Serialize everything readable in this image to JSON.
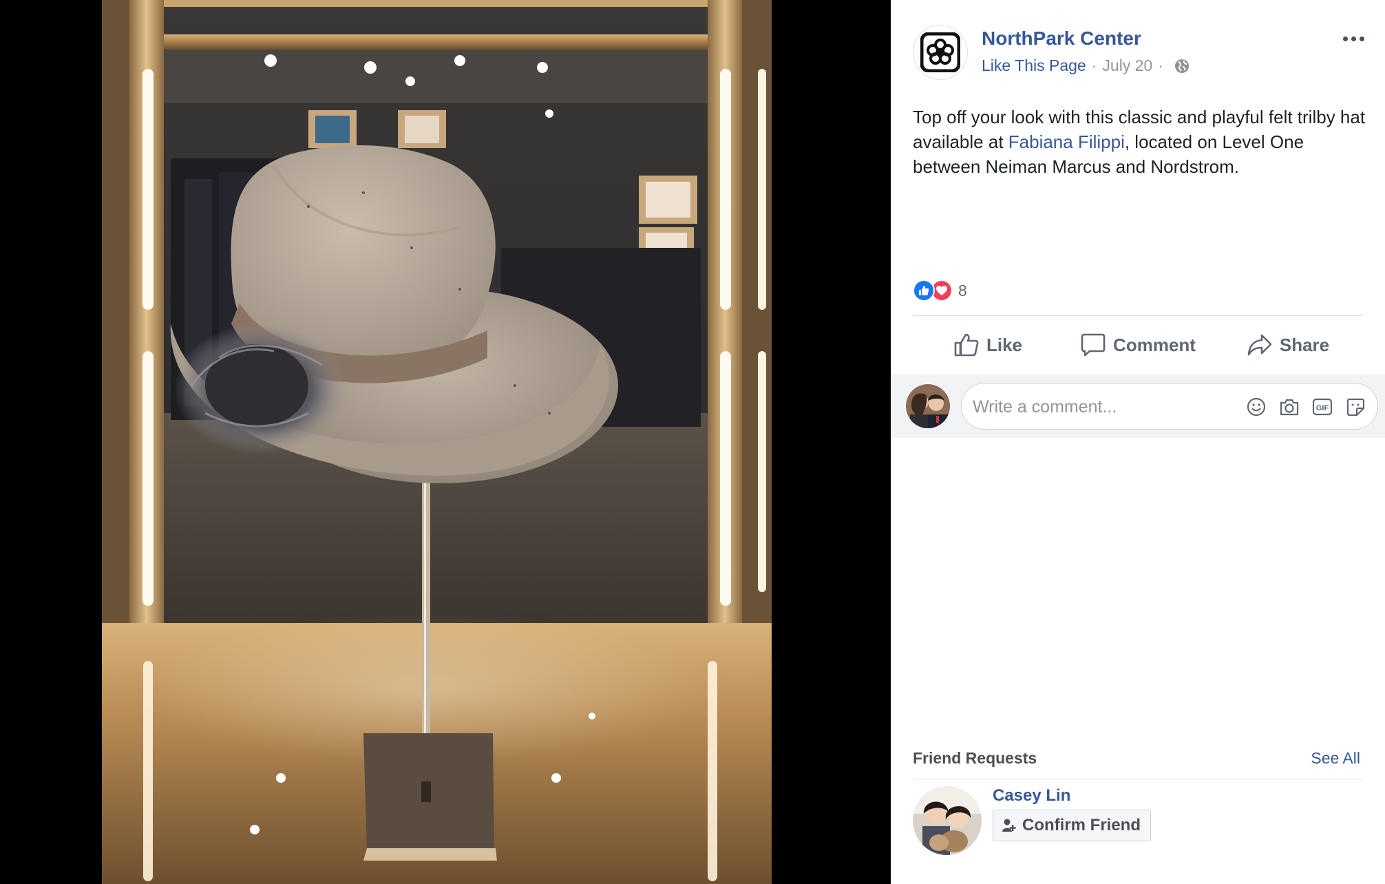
{
  "page": {
    "name": "NorthPark Center",
    "like_link": "Like This Page",
    "separator": "·",
    "date": "July 20"
  },
  "post": {
    "text_before": "Top off your look with this classic and playful felt trilby hat available at ",
    "tag": "Fabiana Filippi",
    "text_after": ", located on Level One between Neiman Marcus and Nordstrom."
  },
  "reactions": {
    "count": "8",
    "types": [
      "like-icon",
      "love-icon"
    ]
  },
  "actions": {
    "like": "Like",
    "comment": "Comment",
    "share": "Share"
  },
  "comment_box": {
    "placeholder": "Write a comment...",
    "tools": [
      "emoji-icon",
      "camera-icon",
      "gif-icon",
      "sticker-icon"
    ]
  },
  "friend_requests": {
    "title": "Friend Requests",
    "see_all": "See All",
    "items": [
      {
        "name": "Casey Lin",
        "button": "Confirm Friend"
      }
    ]
  },
  "colors": {
    "link": "#365899",
    "like_blue": "#1877f2",
    "love_red": "#f33e58",
    "muted": "#90949c"
  }
}
